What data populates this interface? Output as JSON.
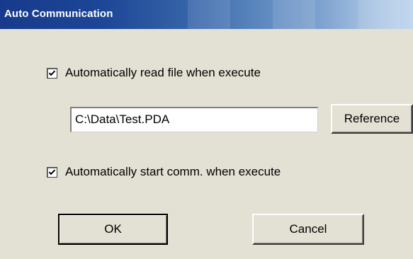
{
  "window": {
    "title": "Auto Communication"
  },
  "options": {
    "read_file": {
      "label": "Automatically read file when execute",
      "checked": true
    },
    "start_comm": {
      "label": "Automatically start comm. when execute",
      "checked": true
    }
  },
  "file_path": {
    "value": "C:\\Data\\Test.PDA"
  },
  "buttons": {
    "reference": "Reference",
    "ok": "OK",
    "cancel": "Cancel"
  },
  "colors": {
    "title_bar_start": "#173a8c",
    "title_bar_end": "#c2d8ef",
    "dialog_background": "#e3e1d3"
  }
}
